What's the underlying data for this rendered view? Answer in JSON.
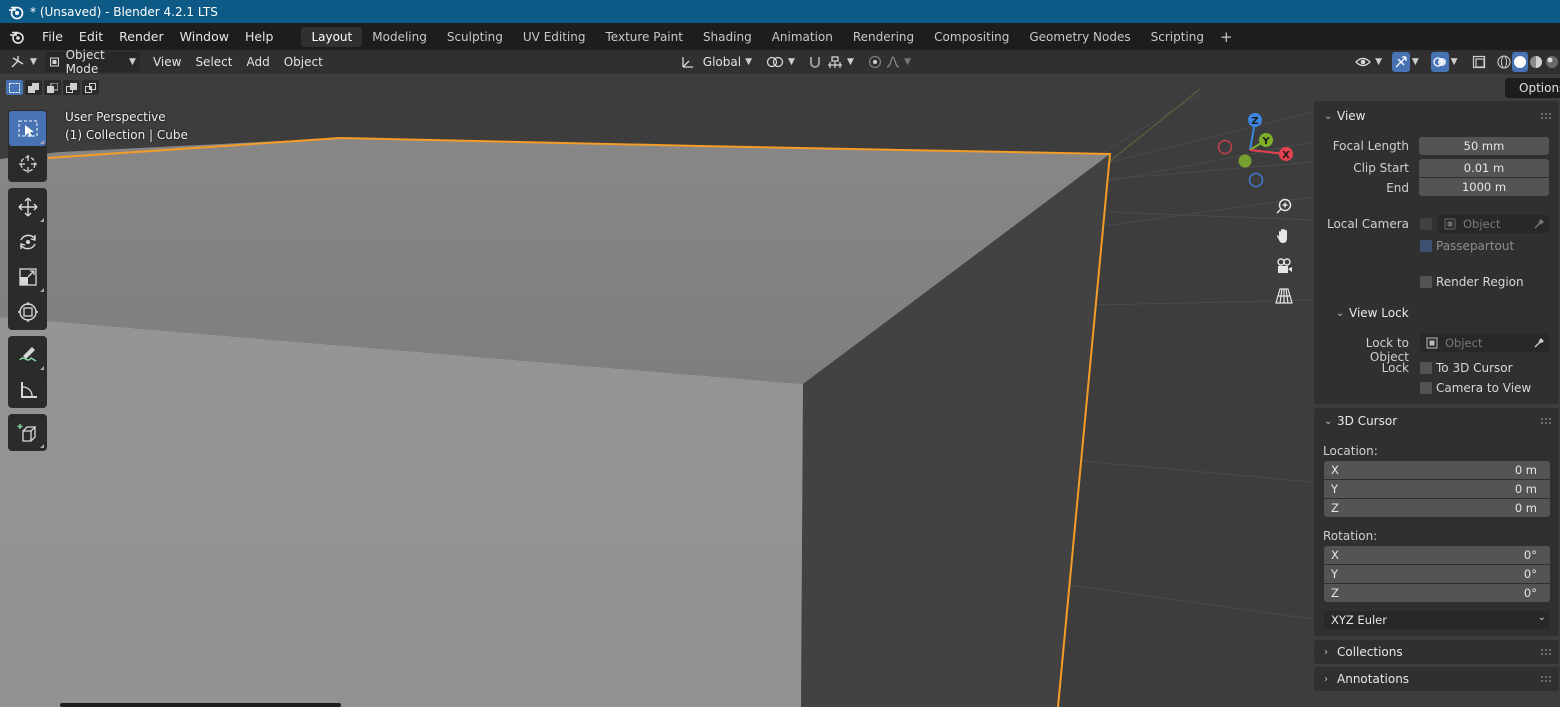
{
  "window": {
    "title": "* (Unsaved) - Blender 4.2.1 LTS",
    "icon": "blender-logo-icon"
  },
  "menubar": {
    "items": [
      "File",
      "Edit",
      "Render",
      "Window",
      "Help"
    ],
    "workspaces": [
      "Layout",
      "Modeling",
      "Sculpting",
      "UV Editing",
      "Texture Paint",
      "Shading",
      "Animation",
      "Rendering",
      "Compositing",
      "Geometry Nodes",
      "Scripting"
    ],
    "active_workspace": "Layout",
    "add_workspace": "+"
  },
  "header": {
    "mode": "Object Mode",
    "menus": [
      "View",
      "Select",
      "Add",
      "Object"
    ],
    "orientation": "Global"
  },
  "viewport": {
    "perspective_label": "User Perspective",
    "collection_label": "(1) Collection | Cube",
    "gizmo": {
      "z": "Z",
      "y": "Y",
      "x": "X"
    },
    "options_label": "Options"
  },
  "toolbar": {
    "tools": [
      "select-box-icon",
      "cursor-icon",
      "move-icon",
      "rotate-icon",
      "scale-icon",
      "transform-icon",
      "annotate-icon",
      "measure-icon",
      "add-cube-icon"
    ]
  },
  "sidebar": {
    "view_panel": {
      "title": "View",
      "focal_length_label": "Focal Length",
      "focal_length": "50 mm",
      "clip_start_label": "Clip Start",
      "clip_start": "0.01 m",
      "end_label": "End",
      "end": "1000 m",
      "local_camera_label": "Local Camera",
      "local_camera_placeholder": "Object",
      "passepartout_label": "Passepartout",
      "render_region_label": "Render Region"
    },
    "view_lock_panel": {
      "title": "View Lock",
      "lock_to_object_label": "Lock to Object",
      "lock_to_object_placeholder": "Object",
      "lock_label": "Lock",
      "to_3d_cursor_label": "To 3D Cursor",
      "camera_to_view_label": "Camera to View"
    },
    "cursor_panel": {
      "title": "3D Cursor",
      "location_label": "Location:",
      "location": [
        {
          "axis": "X",
          "value": "0 m"
        },
        {
          "axis": "Y",
          "value": "0 m"
        },
        {
          "axis": "Z",
          "value": "0 m"
        }
      ],
      "rotation_label": "Rotation:",
      "rotation": [
        {
          "axis": "X",
          "value": "0°"
        },
        {
          "axis": "Y",
          "value": "0°"
        },
        {
          "axis": "Z",
          "value": "0°"
        }
      ],
      "rotation_mode": "XYZ Euler"
    },
    "collections_title": "Collections",
    "annotations_title": "Annotations"
  },
  "colors": {
    "titlebar": "#0e5a86",
    "selection_outline": "#f39c27",
    "accent": "#4772b3",
    "gizmo_x": "#e6414e",
    "gizmo_y": "#7fb02c",
    "gizmo_z": "#3c85e0"
  }
}
